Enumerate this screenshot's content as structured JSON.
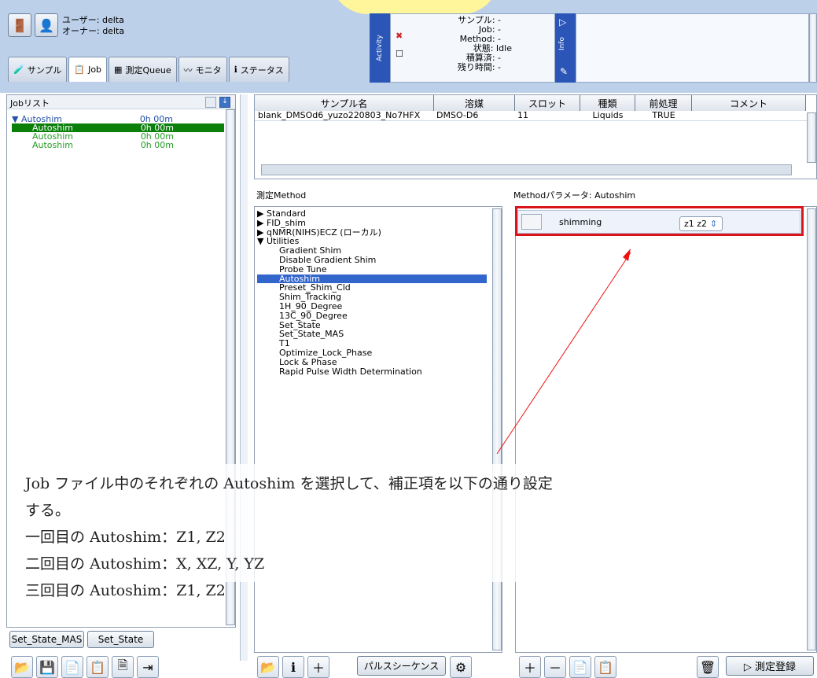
{
  "header": {
    "user_label": "ユーザー: delta",
    "owner_label": "オーナー: delta"
  },
  "tabs": [
    {
      "label": "サンプル"
    },
    {
      "label": "Job"
    },
    {
      "label": "測定Queue"
    },
    {
      "label": "モニタ"
    },
    {
      "label": "ステータス"
    }
  ],
  "activity": {
    "label": "Activity",
    "sample": "サンプル: -",
    "job": "Job: -",
    "method": "Method: -",
    "state": "状態:  Idle",
    "integrated": "積算済: -",
    "remaining": "残り時間: -"
  },
  "info": {
    "label": "Info"
  },
  "left": {
    "title": "Jobリスト",
    "items": [
      {
        "name": "▼ Autoshim",
        "time": "0h 00m"
      },
      {
        "name": "Autoshim",
        "time": "0h 00m"
      },
      {
        "name": "Autoshim",
        "time": "0h 00m"
      },
      {
        "name": "Autoshim",
        "time": "0h 00m"
      }
    ],
    "bottom_buttons": [
      "Set_State_MAS",
      "Set_State"
    ]
  },
  "sample_table": {
    "headers": [
      "サンプル名",
      "溶媒",
      "スロット",
      "種類",
      "前処理",
      "コメント"
    ],
    "row": [
      "blank_DMSOd6_yuzo220803_No7HFX",
      "DMSO-D6",
      "11",
      "Liquids",
      "TRUE",
      ""
    ]
  },
  "method_panel": {
    "title": "測定Method",
    "items": [
      "▶ Standard",
      "▶ FID_shim",
      "▶ qNMR(NIHS)ECZ (ローカル)",
      "▼ Utilities",
      "Gradient Shim",
      "Disable Gradient Shim",
      "Probe Tune",
      "Autoshim",
      "Preset_Shim_Cld",
      "Shim_Tracking",
      "1H_90_Degree",
      "13C_90_Degree",
      "Set_State",
      "Set_State_MAS",
      "T1",
      "Optimize_Lock_Phase",
      "Lock & Phase",
      "Rapid Pulse Width Determination"
    ]
  },
  "params": {
    "title": "Methodパラメータ: Autoshim",
    "name": "shimming",
    "value": "z1 z2"
  },
  "overlay": {
    "lines": [
      "Job ファイル中のそれぞれの Autoshim を選択して、補正項を以下の通り設定する。",
      "一回目の Autoshim：Z1, Z2",
      "二回目の Autoshim：X, XZ, Y, YZ",
      "三回目の Autoshim：Z1, Z2"
    ]
  },
  "bottom": {
    "pulse_label": "パルスシーケンス",
    "submit_label": "▷ 測定登録"
  },
  "colors": {
    "accent": "#2b56b8",
    "selection": "#3366cc",
    "green": "#0a7f0a",
    "red": "#d9141b",
    "highlight": "#fff59a"
  }
}
